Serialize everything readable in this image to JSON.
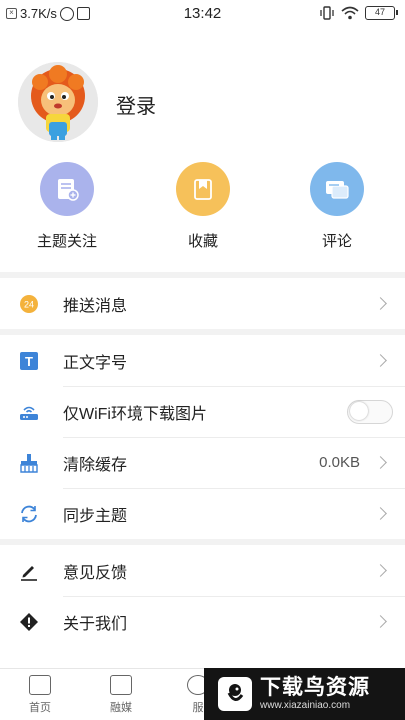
{
  "status_bar": {
    "network_speed": "3.7K/s",
    "time": "13:42",
    "battery": "47"
  },
  "profile": {
    "login_label": "登录"
  },
  "shortcuts": [
    {
      "label": "主题关注",
      "icon": "topic-follow-icon",
      "color": "#aab3ec"
    },
    {
      "label": "收藏",
      "icon": "favorite-icon",
      "color": "#f6c15a"
    },
    {
      "label": "评论",
      "icon": "comment-icon",
      "color": "#7fb8ec"
    }
  ],
  "menu": {
    "push": {
      "label": "推送消息",
      "badge": "24"
    },
    "font_size": {
      "label": "正文字号",
      "icon_text": "T"
    },
    "wifi_images": {
      "label": "仅WiFi环境下载图片",
      "enabled": false
    },
    "clear_cache": {
      "label": "清除缓存",
      "value": "0.0KB"
    },
    "sync_topics": {
      "label": "同步主题"
    },
    "feedback": {
      "label": "意见反馈"
    },
    "about": {
      "label": "关于我们"
    }
  },
  "bottom_nav": [
    {
      "label": "首页",
      "icon": "home-news-icon"
    },
    {
      "label": "融媒",
      "icon": "media-icon"
    },
    {
      "label": "服",
      "icon": "service-icon"
    }
  ],
  "watermark": {
    "title": "下载鸟资源",
    "url": "www.xiazainiao.com"
  }
}
